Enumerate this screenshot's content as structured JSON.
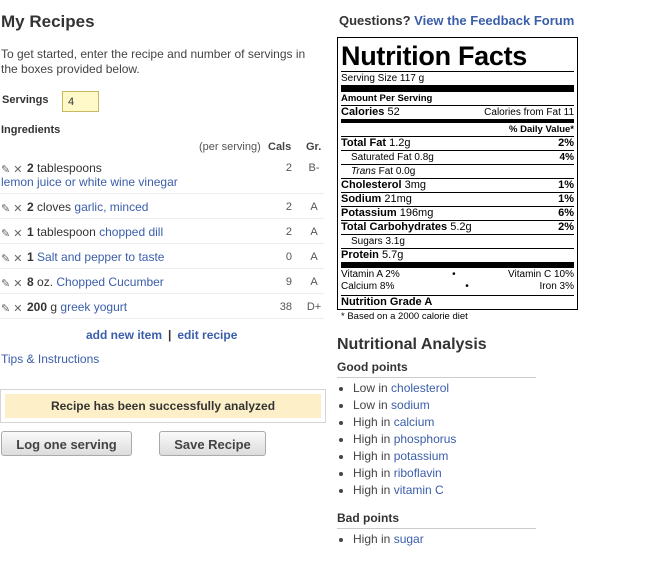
{
  "left": {
    "title": "My Recipes",
    "intro": "To get started, enter the recipe and number of servings in the boxes provided below.",
    "servings_label": "Servings",
    "servings_value": "4",
    "ingredients_label": "Ingredients",
    "columns": {
      "per_serving": "(per serving)",
      "cals": "Cals",
      "grade": "Gr."
    },
    "ingredients": [
      {
        "qty": "2",
        "unit": "tablespoons",
        "name": "lemon juice or white wine vinegar",
        "cals": "2",
        "grade": "B-"
      },
      {
        "qty": "2",
        "unit": "cloves",
        "name": "garlic, minced",
        "cals": "2",
        "grade": "A"
      },
      {
        "qty": "1",
        "unit": "tablespoon",
        "name": "chopped dill",
        "cals": "2",
        "grade": "A"
      },
      {
        "qty": "1",
        "unit": "",
        "name": "Salt and pepper to taste",
        "cals": "0",
        "grade": "A"
      },
      {
        "qty": "8",
        "unit": "oz.",
        "name": "Chopped Cucumber",
        "cals": "9",
        "grade": "A"
      },
      {
        "qty": "200",
        "unit": "g",
        "name": "greek yogurt",
        "cals": "38",
        "grade": "D+"
      }
    ],
    "add_item": "add new item",
    "separator": "|",
    "edit_recipe": "edit recipe",
    "tips": "Tips & Instructions",
    "success": "Recipe has been successfully analyzed",
    "log_button": "Log one serving",
    "save_button": "Save Recipe"
  },
  "right": {
    "questions_text": "Questions?",
    "feedback_link": "View the Feedback Forum",
    "nutrition": {
      "title": "Nutrition Facts",
      "serving_size": "Serving Size 117 g",
      "amount_per_serving": "Amount Per Serving",
      "calories_label": "Calories",
      "calories_value": "52",
      "calories_fat": "Calories from Fat 11",
      "dv_header": "% Daily Value*",
      "total_fat": "Total Fat",
      "total_fat_value": "1.2g",
      "total_fat_dv": "2%",
      "sat_fat": "Saturated Fat 0.8g",
      "sat_fat_dv": "4%",
      "trans_fat_label": "Trans",
      "trans_fat_rest": "Fat 0.0g",
      "cholesterol": "Cholesterol",
      "cholesterol_value": "3mg",
      "cholesterol_dv": "1%",
      "sodium": "Sodium",
      "sodium_value": "21mg",
      "sodium_dv": "1%",
      "potassium": "Potassium",
      "potassium_value": "196mg",
      "potassium_dv": "6%",
      "carbs": "Total Carbohydrates",
      "carbs_value": "5.2g",
      "carbs_dv": "2%",
      "sugars": "Sugars 3.1g",
      "protein": "Protein",
      "protein_value": "5.7g",
      "vit_a": "Vitamin A 2%",
      "bullet": "•",
      "vit_c": "Vitamin C 10%",
      "calcium": "Calcium 8%",
      "iron": "Iron 3%",
      "grade": "Nutrition Grade A",
      "footnote": "* Based on a 2000 calorie diet"
    },
    "analysis": {
      "title": "Nutritional Analysis",
      "good_label": "Good points",
      "good": [
        {
          "level": "Low in",
          "item": "cholesterol"
        },
        {
          "level": "Low in",
          "item": "sodium"
        },
        {
          "level": "High in",
          "item": "calcium"
        },
        {
          "level": "High in",
          "item": "phosphorus"
        },
        {
          "level": "High in",
          "item": "potassium"
        },
        {
          "level": "High in",
          "item": "riboflavin"
        },
        {
          "level": "High in",
          "item": "vitamin C"
        }
      ],
      "bad_label": "Bad points",
      "bad": [
        {
          "level": "High in",
          "item": "sugar"
        }
      ]
    }
  },
  "icons": {
    "edit": "pencil-icon",
    "delete": "close-icon"
  },
  "colors": {
    "link": "#3b5eab",
    "success_bg": "#fdf0c8",
    "servings_bg": "#fff8c8"
  }
}
